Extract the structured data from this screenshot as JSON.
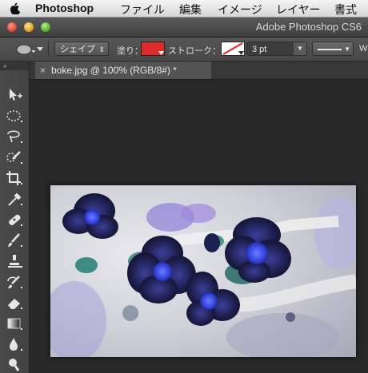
{
  "menubar": {
    "app_name": "Photoshop",
    "items": [
      "ファイル",
      "編集",
      "イメージ",
      "レイヤー",
      "書式"
    ]
  },
  "window": {
    "title": "Adobe Photoshop CS6"
  },
  "options": {
    "mode_select": "シェイプ",
    "fill_label": "塗り：",
    "fill_color": "#e02a2a",
    "stroke_label": "ストローク：",
    "stroke_size": "3 pt",
    "cut_label": "W"
  },
  "document": {
    "tab_label": "boke.jpg @ 100% (RGB/8#) *",
    "close_glyph": "×"
  },
  "tools": [
    "move-tool",
    "elliptical-marquee-tool",
    "lasso-tool",
    "quick-selection-tool",
    "crop-tool",
    "eyedropper-tool",
    "spot-healing-brush-tool",
    "brush-tool",
    "clone-stamp-tool",
    "history-brush-tool",
    "eraser-tool",
    "gradient-tool",
    "blur-tool",
    "dodge-tool"
  ]
}
